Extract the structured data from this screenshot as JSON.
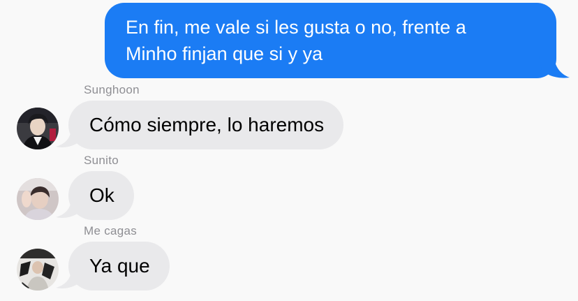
{
  "outgoing": {
    "line1": "En fin, me vale si les gusta o no, frente a",
    "line2": "Minho finjan que si y ya"
  },
  "messages": [
    {
      "sender": "Sunghoon",
      "text": "Cómo siempre, lo haremos"
    },
    {
      "sender": "Sunito",
      "text": "Ok"
    },
    {
      "sender": "Me cagas",
      "text": "Ya que"
    }
  ],
  "colors": {
    "outgoing_bubble": "#1b7cf4",
    "incoming_bubble": "#e9e9eb",
    "sender_label": "#8e8e93",
    "background": "#f9f9f9"
  }
}
